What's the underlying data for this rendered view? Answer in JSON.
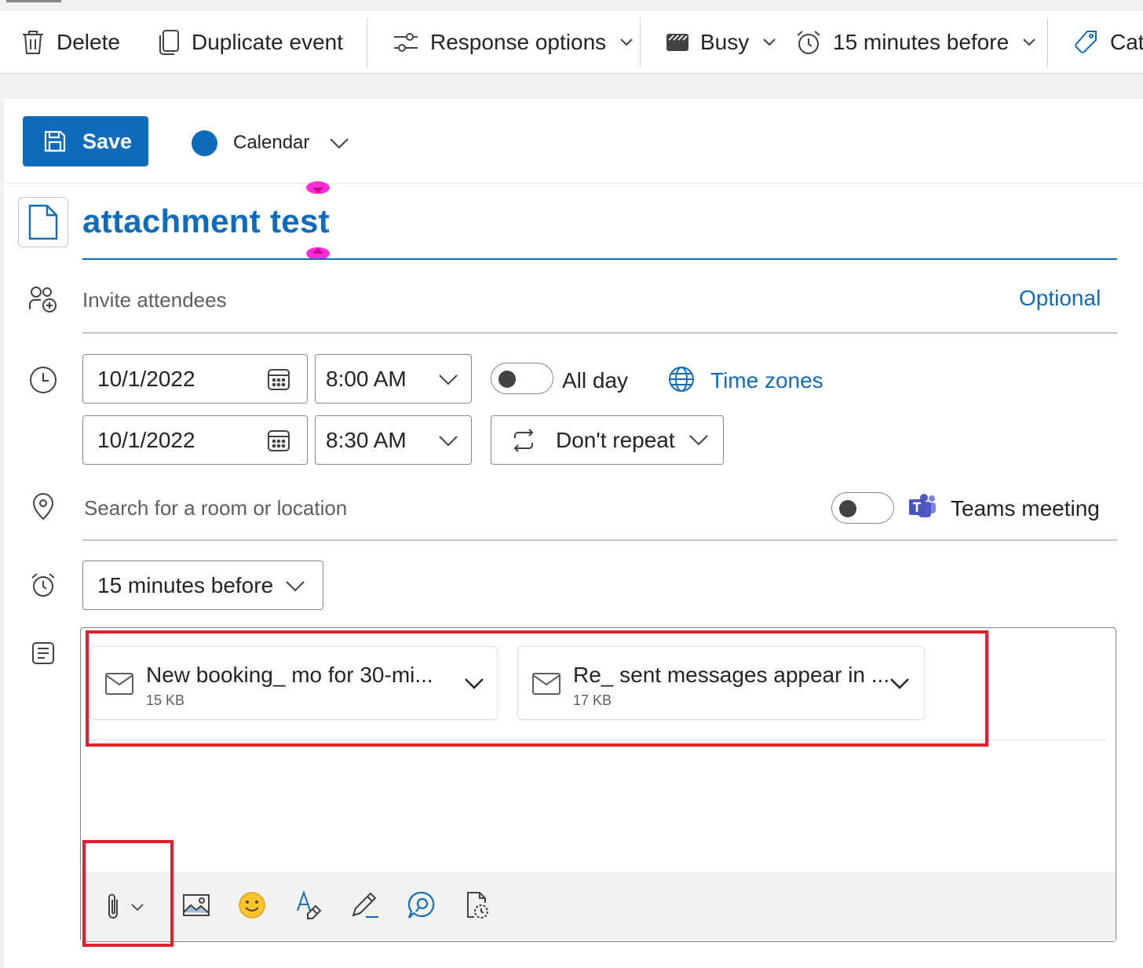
{
  "toolbar": {
    "delete_label": "Delete",
    "duplicate_label": "Duplicate event",
    "response_label": "Response options",
    "busy_label": "Busy",
    "reminder_label": "15 minutes before",
    "categorize_label": "Cate"
  },
  "header": {
    "save_label": "Save",
    "calendar_label": "Calendar",
    "calendar_color": "#0f6cbd"
  },
  "event": {
    "title": "attachment test",
    "attendees_placeholder": "Invite attendees",
    "optional_label": "Optional",
    "start_date": "10/1/2022",
    "start_time": "8:00 AM",
    "end_date": "10/1/2022",
    "end_time": "8:30 AM",
    "all_day_label": "All day",
    "time_zones_label": "Time zones",
    "repeat_label": "Don't repeat",
    "location_placeholder": "Search for a room or location",
    "teams_label": "Teams meeting",
    "reminder_value": "15 minutes before"
  },
  "attachments": [
    {
      "name": "New booking_ mo for 30-mi...",
      "size": "15 KB",
      "icon": "mail-icon"
    },
    {
      "name": "Re_ sent messages appear in ...",
      "size": "17 KB",
      "icon": "mail-icon"
    }
  ],
  "formatting_toolbar": [
    "paperclip-icon",
    "image-icon",
    "emoji-icon",
    "format-painter-icon",
    "draw-icon",
    "editor-icon",
    "loop-icon"
  ],
  "colors": {
    "accent": "#0f6cbd",
    "highlight": "#e0202e",
    "caret_handle": "#ff2bd6"
  }
}
